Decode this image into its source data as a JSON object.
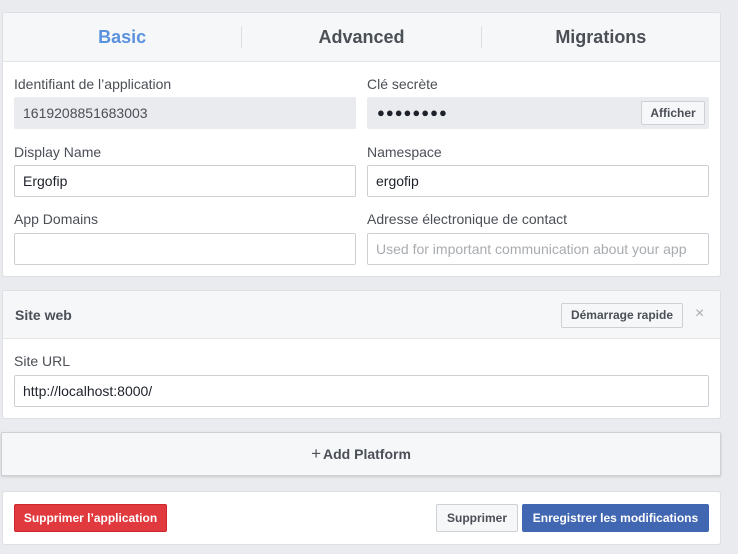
{
  "tabs": [
    {
      "label": "Basic",
      "active": true
    },
    {
      "label": "Advanced",
      "active": false
    },
    {
      "label": "Migrations",
      "active": false
    }
  ],
  "basic": {
    "app_id_label": "Identifiant de l’application",
    "app_id_value": "1619208851683003",
    "secret_label": "Clé secrète",
    "secret_value": "●●●●●●●●",
    "secret_show_button": "Afficher",
    "display_name_label": "Display Name",
    "display_name_value": "Ergofip",
    "namespace_label": "Namespace",
    "namespace_value": "ergofip",
    "app_domains_label": "App Domains",
    "app_domains_value": "",
    "contact_email_label": "Adresse électronique de contact",
    "contact_email_placeholder": "Used for important communication about your app"
  },
  "site": {
    "title": "Site web",
    "quick_start_button": "Démarrage rapide",
    "close_icon": "×",
    "url_label": "Site URL",
    "url_value": "http://localhost:8000/"
  },
  "add_platform": {
    "plus": "+",
    "label": "Add Platform"
  },
  "footer": {
    "delete_app_button": "Supprimer l’application",
    "delete_button": "Supprimer",
    "save_button": "Enregistrer les modifications"
  },
  "colors": {
    "active_tab": "#5b92dd",
    "danger": "#e0393e",
    "primary": "#4267b2",
    "background": "#e9ebee"
  }
}
